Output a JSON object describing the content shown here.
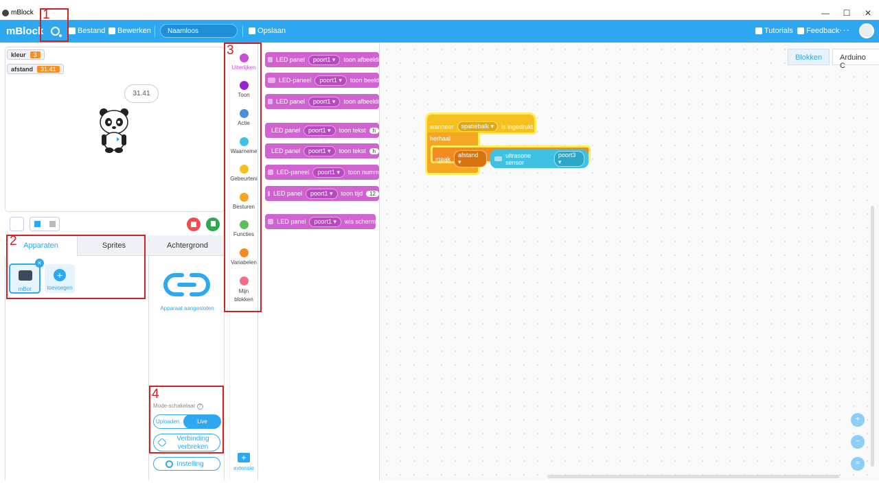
{
  "window": {
    "title": "mBlock",
    "controls": [
      "—",
      "☐",
      "✕"
    ]
  },
  "menubar": {
    "logo": "mBlock",
    "file": "Bestand",
    "edit": "Bewerken",
    "project_name": "Naamloos",
    "save": "Opslaan",
    "tutorials": "Tutorials",
    "feedback": "Feedback",
    "more": "···"
  },
  "annotations": {
    "n1": "1",
    "n2": "2",
    "n3": "3",
    "n4": "4",
    "color": "#d42020"
  },
  "stage": {
    "monitors": [
      {
        "label": "kleur",
        "value": "3"
      },
      {
        "label": "afstand",
        "value": "31.41"
      }
    ],
    "speech": "31.41"
  },
  "tabs": {
    "devices": "Apparaten",
    "sprites": "Sprites",
    "background": "Achtergrond"
  },
  "devices": {
    "mbot": "mBot",
    "add": "toevoegen",
    "add_symbol": "+",
    "close_symbol": "✕"
  },
  "connection": {
    "status": "Apparaat aangesloten",
    "mode_label": "Mode-schakelaar",
    "mode_help": "?",
    "upload": "Uploaden",
    "live": "Live",
    "disconnect": "Verbinding verbreken",
    "settings": "Instelling"
  },
  "categories": [
    {
      "label": "Uiterlijken",
      "color": "#c34fd6"
    },
    {
      "label": "Toon",
      "color": "#9b1ed8"
    },
    {
      "label": "Actie",
      "color": "#4a90d9"
    },
    {
      "label": "Waarneme",
      "color": "#3ec1e3"
    },
    {
      "label": "Gebeurteni",
      "color": "#f5c020"
    },
    {
      "label": "Besturen",
      "color": "#f5a623"
    },
    {
      "label": "Functies",
      "color": "#59c059"
    },
    {
      "label": "Variabelen",
      "color": "#f58a20"
    },
    {
      "label": "Mijn blokken",
      "color": "#f06e8a"
    }
  ],
  "extension": {
    "label": "extensie",
    "symbol": "+"
  },
  "blocks": [
    {
      "a": "LED panel",
      "port": "poort1 ▾",
      "b": "toon afbeeldi",
      "inp": ""
    },
    {
      "a": "LED-paneel",
      "port": "poort1 ▾",
      "b": "toon beeld",
      "inp": ""
    },
    {
      "a": "LED panel",
      "port": "poort1 ▾",
      "b": "toon afbeeldi",
      "inp": ""
    },
    {
      "a": "LED panel",
      "port": "poort1 ▾",
      "b": "toon tekst",
      "inp": "h"
    },
    {
      "a": "LED panel",
      "port": "poort1 ▾",
      "b": "toon tekst",
      "inp": "h"
    },
    {
      "a": "LED-paneel",
      "port": "poort1 ▾",
      "b": "toon numm",
      "inp": ""
    },
    {
      "a": "LED panel",
      "port": "poort1 ▾",
      "b": "toon tijd",
      "inp": "12"
    },
    {
      "a": "LED panel",
      "port": "poort1 ▾",
      "b": "wis scherm",
      "inp": ""
    }
  ],
  "canvas_tabs": {
    "blocks": "Blokken",
    "arduino": "Arduino C"
  },
  "script": {
    "hat_a": "wanneer",
    "hat_key": "spatiebalk ▾",
    "hat_b": "is ingedrukt",
    "loop": "herhaal",
    "set": "maak",
    "var": "afstand ▾",
    "sensor": "ultrasone sensor",
    "port": "poort3 ▾",
    "loop_arrow": "↻"
  },
  "zoom": {
    "in": "+",
    "out": "−",
    "reset": "="
  }
}
